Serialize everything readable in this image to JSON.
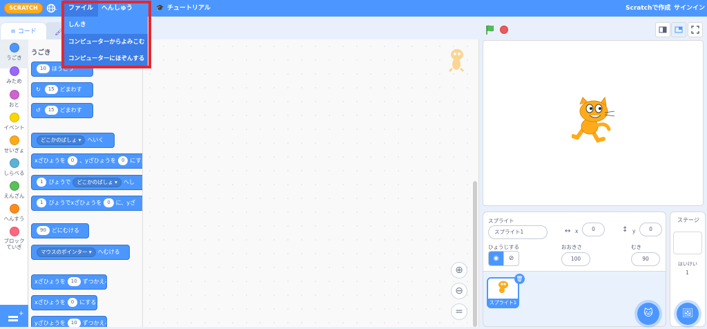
{
  "menubar": {
    "logo": "SCRATCH",
    "file_label": "ファイル",
    "edit_label": "へんしゅう",
    "tutorial_label": "チュートリアル",
    "create_label": "Scratchで作成",
    "signin_label": "サインイン"
  },
  "file_menu": {
    "items": [
      "しんき",
      "コンピューターからよみこむ",
      "コンピューターにほぞんする"
    ]
  },
  "tabs": {
    "code_label": "コード"
  },
  "categories": [
    {
      "label": "うごき",
      "color": "#4c97ff"
    },
    {
      "label": "みため",
      "color": "#9966ff"
    },
    {
      "label": "おと",
      "color": "#cf63cf"
    },
    {
      "label": "イベント",
      "color": "#ffd500"
    },
    {
      "label": "せいぎょ",
      "color": "#ffab19"
    },
    {
      "label": "しらべる",
      "color": "#5cb1d6"
    },
    {
      "label": "えんざん",
      "color": "#59c059"
    },
    {
      "label": "へんすう",
      "color": "#ff8c1a"
    },
    {
      "label": "ブロックていぎ",
      "color": "#ff6680"
    }
  ],
  "palette": {
    "heading": "うごき",
    "move": {
      "value": "10",
      "text": "ほうこう"
    },
    "turn_right": {
      "value": "15",
      "text": "どまわす"
    },
    "turn_left": {
      "value": "15",
      "text": "どまわす"
    },
    "goto": {
      "dropdown": "どこかのばしょ",
      "text": "へいく"
    },
    "goto_xy": {
      "t1": "xざひょうを",
      "x": "0",
      "t2": "、yざひょうを",
      "y": "0",
      "t3": "にする"
    },
    "glide": {
      "value": "1",
      "t1": "びょうで",
      "dropdown": "どこかのばしょ",
      "t2": "へし"
    },
    "glide_xy": {
      "value": "1",
      "t1": "びょうでxざひょうを",
      "x": "0",
      "t2": "に、yざ"
    },
    "point_dir": {
      "value": "90",
      "text": "どにむける"
    },
    "point_towards": {
      "dropdown": "マウスのポインター",
      "text": "へむける"
    },
    "change_x": {
      "t1": "xざひょうを",
      "value": "10",
      "t2": "ずつかえる"
    },
    "set_x": {
      "t1": "xざひょうを",
      "value": "0",
      "t2": "にする"
    },
    "change_y": {
      "t1": "yざひょうを",
      "value": "10",
      "t2": "ずつかえる"
    }
  },
  "sprite_info": {
    "sprite_label": "スプライト",
    "sprite_name": "スプライト1",
    "x_label": "x",
    "x_value": "0",
    "y_label": "y",
    "y_value": "0",
    "show_label": "ひょうじする",
    "size_label": "おおきさ",
    "size_value": "100",
    "direction_label": "むき",
    "direction_value": "90",
    "thumb_label": "スプライト1"
  },
  "stage_pane": {
    "title": "ステージ",
    "backdrops_label": "はいけい",
    "backdrops_count": "1"
  },
  "colors": {
    "accent": "#4c97ff",
    "highlight": "#e8262e",
    "menubar": "#4c97ff"
  }
}
